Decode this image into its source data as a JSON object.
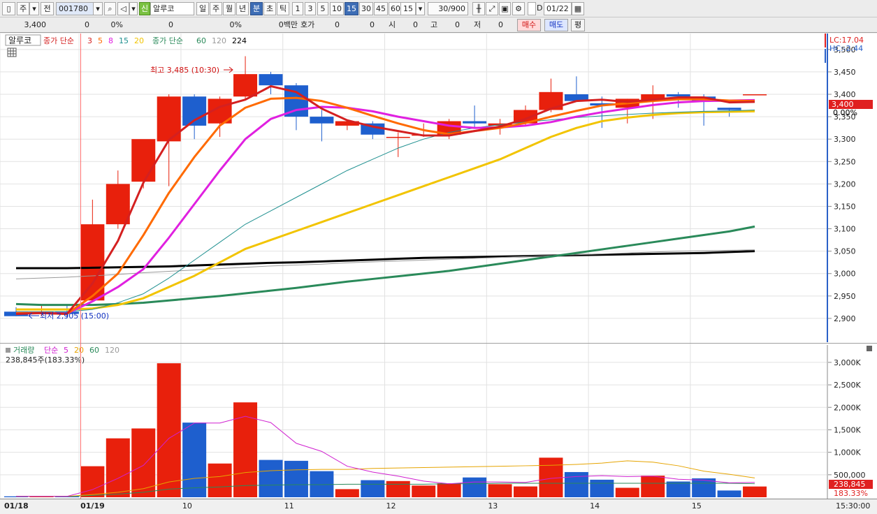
{
  "toolbar": {
    "period_prefix": "주",
    "prev_label": "전",
    "code": "001780",
    "stock_tag": "신",
    "stock_name": "알루코",
    "periods": [
      "일",
      "주",
      "월",
      "년",
      "분",
      "초",
      "틱"
    ],
    "active_period": "분",
    "minutes": [
      "1",
      "3",
      "5",
      "10",
      "15",
      "30",
      "45",
      "60"
    ],
    "active_minute": "15",
    "interval_value": "15",
    "count": "30/900",
    "d_label": "D",
    "date": "01/22"
  },
  "quote": {
    "price": "3,400",
    "change": "0",
    "change_pct": "0%",
    "volume": "0",
    "volume_pct": "0%",
    "amount_unit": "0백만",
    "hoga_label": "호가",
    "hoga_val1": "0",
    "hoga_val2": "0",
    "open_label": "시",
    "open_val": "0",
    "high_label": "고",
    "high_val": "0",
    "low_label": "저",
    "low_val": "0",
    "buy_label": "매수",
    "sell_label": "매도",
    "avg_label": "평"
  },
  "price_pane": {
    "name_box": "알루코",
    "legend_a_title": "종가 단순",
    "legend_a_periods": [
      "3",
      "5",
      "8",
      "15",
      "20"
    ],
    "legend_a_colors": [
      "#d42020",
      "#ff6a00",
      "#e020e0",
      "#1f9090",
      "#f2c400"
    ],
    "legend_b_title": "종가 단순",
    "legend_b_periods": [
      "60",
      "120",
      "224"
    ],
    "legend_b_colors": [
      "#2a8a5a",
      "#9a9a9a",
      "#000000"
    ],
    "lc_label": "LC:17.04",
    "hc_label": "HC:-2.44",
    "high_annotation": "최고 3,485 (10:30)",
    "low_annotation": "최저 2,905 (15:00)",
    "current_price_tag": "3,400",
    "current_pct_tag": "0.00%"
  },
  "volume_pane": {
    "legend_title": "거래량",
    "legend_ma_title": "단순",
    "legend_periods": [
      "5",
      "20",
      "60",
      "120"
    ],
    "legend_colors": [
      "#d020d0",
      "#e6a400",
      "#2a8a5a",
      "#9a9a9a"
    ],
    "current_text": "238,845주(183.33%)",
    "current_tag": "238,845",
    "current_pct_tag": "183.33%"
  },
  "time_axis": {
    "labels": [
      {
        "text": "01/18",
        "idx": 0,
        "bold": true
      },
      {
        "text": "01/19",
        "idx": 3,
        "bold": true
      },
      {
        "text": "10",
        "idx": 7
      },
      {
        "text": "11",
        "idx": 11
      },
      {
        "text": "12",
        "idx": 15
      },
      {
        "text": "13",
        "idx": 19
      },
      {
        "text": "14",
        "idx": 23
      },
      {
        "text": "15",
        "idx": 27
      }
    ],
    "current_time": "15:30:00"
  },
  "chart_data": {
    "type": "candlestick",
    "price_ylim": [
      2850,
      3520
    ],
    "price_ticks": [
      "3,500",
      "3,450",
      "3,400",
      "3,350",
      "3,300",
      "3,250",
      "3,200",
      "3,150",
      "3,100",
      "3,050",
      "3,000",
      "2,950",
      "2,900"
    ],
    "volume_ylim": [
      0,
      3200000
    ],
    "volume_ticks": [
      "3,000K",
      "2,500K",
      "2,000K",
      "1,500K",
      "1,000K",
      "500,000"
    ],
    "candles": [
      {
        "o": 2915,
        "h": 2925,
        "l": 2905,
        "c": 2905
      },
      {
        "o": 2915,
        "h": 2930,
        "l": 2905,
        "c": 2915
      },
      {
        "o": 2915,
        "h": 2930,
        "l": 2900,
        "c": 2910
      },
      {
        "o": 2940,
        "h": 3165,
        "l": 2940,
        "c": 3110
      },
      {
        "o": 3110,
        "h": 3230,
        "l": 3100,
        "c": 3200
      },
      {
        "o": 3205,
        "h": 3295,
        "l": 3190,
        "c": 3300
      },
      {
        "o": 3295,
        "h": 3400,
        "l": 3195,
        "c": 3395
      },
      {
        "o": 3395,
        "h": 3400,
        "l": 3300,
        "c": 3330
      },
      {
        "o": 3335,
        "h": 3395,
        "l": 3305,
        "c": 3390
      },
      {
        "o": 3395,
        "h": 3485,
        "l": 3390,
        "c": 3445
      },
      {
        "o": 3445,
        "h": 3450,
        "l": 3400,
        "c": 3420
      },
      {
        "o": 3420,
        "h": 3425,
        "l": 3320,
        "c": 3350
      },
      {
        "o": 3350,
        "h": 3365,
        "l": 3295,
        "c": 3335
      },
      {
        "o": 3330,
        "h": 3340,
        "l": 3320,
        "c": 3340
      },
      {
        "o": 3335,
        "h": 3340,
        "l": 3300,
        "c": 3310
      },
      {
        "o": 3305,
        "h": 3315,
        "l": 3260,
        "c": 3305
      },
      {
        "o": 3310,
        "h": 3335,
        "l": 3305,
        "c": 3310
      },
      {
        "o": 3310,
        "h": 3345,
        "l": 3300,
        "c": 3340
      },
      {
        "o": 3340,
        "h": 3375,
        "l": 3325,
        "c": 3335
      },
      {
        "o": 3330,
        "h": 3345,
        "l": 3310,
        "c": 3335
      },
      {
        "o": 3335,
        "h": 3375,
        "l": 3330,
        "c": 3365
      },
      {
        "o": 3365,
        "h": 3435,
        "l": 3360,
        "c": 3405
      },
      {
        "o": 3400,
        "h": 3440,
        "l": 3385,
        "c": 3385
      },
      {
        "o": 3380,
        "h": 3395,
        "l": 3325,
        "c": 3375
      },
      {
        "o": 3370,
        "h": 3390,
        "l": 3335,
        "c": 3390
      },
      {
        "o": 3385,
        "h": 3420,
        "l": 3345,
        "c": 3400
      },
      {
        "o": 3400,
        "h": 3405,
        "l": 3370,
        "c": 3395
      },
      {
        "o": 3395,
        "h": 3400,
        "l": 3330,
        "c": 3385
      },
      {
        "o": 3370,
        "h": 3370,
        "l": 3350,
        "c": 3365
      },
      {
        "o": 3400,
        "h": 3400,
        "l": 3400,
        "c": 3400
      }
    ],
    "volumes": [
      20000,
      20000,
      20000,
      690000,
      1310000,
      1530000,
      2980000,
      1660000,
      750000,
      2110000,
      830000,
      810000,
      580000,
      180000,
      380000,
      360000,
      260000,
      310000,
      440000,
      290000,
      240000,
      880000,
      560000,
      390000,
      210000,
      480000,
      350000,
      420000,
      150000,
      238845
    ],
    "ma": {
      "3": [
        2910,
        2912,
        2910,
        2978,
        3073,
        3203,
        3298,
        3342,
        3372,
        3388,
        3418,
        3405,
        3368,
        3342,
        3328,
        3318,
        3308,
        3308,
        3318,
        3328,
        3345,
        3368,
        3385,
        3388,
        3383,
        3388,
        3393,
        3393,
        3382,
        3383
      ],
      "5": [
        2912,
        2912,
        2910,
        2950,
        3000,
        3086,
        3180,
        3260,
        3330,
        3370,
        3390,
        3392,
        3385,
        3370,
        3352,
        3335,
        3320,
        3311,
        3318,
        3325,
        3336,
        3350,
        3363,
        3375,
        3380,
        3385,
        3389,
        3389,
        3386,
        3385
      ],
      "8": [
        2912,
        2912,
        2911,
        2938,
        2970,
        3010,
        3080,
        3155,
        3230,
        3300,
        3345,
        3365,
        3372,
        3370,
        3362,
        3350,
        3340,
        3330,
        3325,
        3326,
        3330,
        3338,
        3350,
        3360,
        3368,
        3376,
        3382,
        3385,
        3386,
        3387
      ],
      "15": [
        2915,
        2915,
        2915,
        2920,
        2935,
        2955,
        2990,
        3030,
        3070,
        3110,
        3140,
        3170,
        3200,
        3230,
        3255,
        3280,
        3300,
        3315,
        3325,
        3332,
        3338,
        3343,
        3348,
        3352,
        3355,
        3358,
        3360,
        3362,
        3363,
        3365
      ],
      "20": [
        2920,
        2920,
        2920,
        2922,
        2930,
        2945,
        2970,
        2995,
        3025,
        3055,
        3075,
        3095,
        3115,
        3135,
        3155,
        3175,
        3195,
        3215,
        3235,
        3255,
        3280,
        3305,
        3325,
        3340,
        3348,
        3354,
        3358,
        3360,
        3361,
        3362
      ],
      "60": [
        2932,
        2930,
        2930,
        2930,
        2932,
        2935,
        2940,
        2945,
        2950,
        2956,
        2962,
        2968,
        2975,
        2982,
        2988,
        2994,
        3000,
        3006,
        3014,
        3022,
        3030,
        3038,
        3046,
        3054,
        3062,
        3070,
        3078,
        3086,
        3094,
        3105
      ],
      "120": [
        2988,
        2990,
        2992,
        2995,
        2998,
        3002,
        3005,
        3008,
        3011,
        3014,
        3017,
        3019,
        3021,
        3024,
        3026,
        3028,
        3030,
        3032,
        3034,
        3036,
        3038,
        3040,
        3042,
        3044,
        3046,
        3048,
        3050,
        3051,
        3052,
        3053
      ],
      "224": [
        3012,
        3012,
        3012,
        3013,
        3014,
        3015,
        3016,
        3018,
        3020,
        3022,
        3024,
        3025,
        3027,
        3029,
        3031,
        3033,
        3035,
        3036,
        3037,
        3038,
        3039,
        3040,
        3041,
        3042,
        3043,
        3044,
        3045,
        3046,
        3048,
        3050
      ]
    },
    "volume_ma": {
      "5": [
        20000,
        20000,
        20000,
        170000,
        420000,
        710000,
        1310000,
        1650000,
        1650000,
        1800000,
        1660000,
        1200000,
        1020000,
        690000,
        560000,
        470000,
        360000,
        300000,
        340000,
        340000,
        330000,
        420000,
        460000,
        480000,
        460000,
        470000,
        400000,
        380000,
        320000,
        330000
      ],
      "20": [
        20000,
        20000,
        20000,
        60000,
        110000,
        190000,
        340000,
        420000,
        460000,
        550000,
        590000,
        610000,
        620000,
        620000,
        640000,
        650000,
        660000,
        670000,
        680000,
        690000,
        700000,
        710000,
        730000,
        760000,
        810000,
        780000,
        700000,
        580000,
        510000,
        430000
      ],
      "60": [
        20000,
        20000,
        20000,
        40000,
        70000,
        110000,
        180000,
        210000,
        230000,
        260000,
        270000,
        280000,
        280000,
        290000,
        290000,
        290000,
        290000,
        300000,
        300000,
        310000,
        310000,
        310000,
        310000,
        310000,
        310000,
        310000,
        310000,
        310000,
        310000,
        300000
      ]
    },
    "colors": {
      "up": "#e8200c",
      "down": "#1e5fce"
    }
  }
}
